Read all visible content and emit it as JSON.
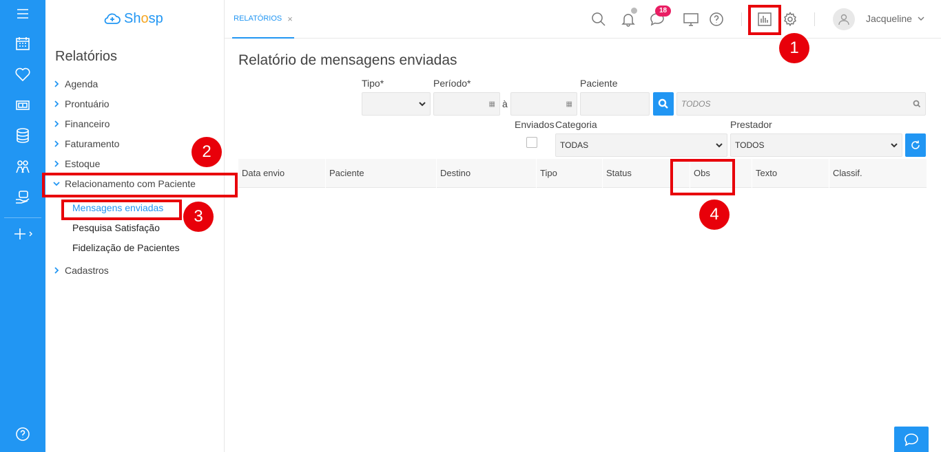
{
  "app": {
    "logo_text_start": "Sh",
    "logo_text_o": "o",
    "logo_text_end": "sp"
  },
  "rail": {
    "icons": [
      "menu-icon",
      "calendar-icon",
      "heart-icon",
      "money-icon",
      "database-icon",
      "people-icon",
      "hand-care-icon",
      "plus-icon"
    ]
  },
  "sidebar": {
    "title": "Relatórios",
    "items": [
      {
        "label": "Agenda"
      },
      {
        "label": "Prontuário"
      },
      {
        "label": "Financeiro"
      },
      {
        "label": "Faturamento"
      },
      {
        "label": "Estoque"
      },
      {
        "label": "Relacionamento com Paciente"
      },
      {
        "label": "Cadastros"
      }
    ],
    "subitems": [
      {
        "label": "Mensagens enviadas"
      },
      {
        "label": "Pesquisa Satisfação"
      },
      {
        "label": "Fidelização de Pacientes"
      }
    ]
  },
  "topbar": {
    "tab_label": "RELATÓRIOS",
    "tab_close": "×",
    "messages_badge": "18",
    "username": "Jacqueline"
  },
  "main": {
    "title": "Relatório de mensagens enviadas",
    "filters": {
      "tipo_label": "Tipo*",
      "periodo_label": "Período*",
      "periodo_sep": "à",
      "paciente_label": "Paciente",
      "paciente_search_placeholder": "TODOS",
      "enviados_label": "Enviados",
      "categoria_label": "Categoria",
      "categoria_value": "TODAS",
      "prestador_label": "Prestador",
      "prestador_value": "TODOS"
    },
    "table_headers": [
      "Data envio",
      "Paciente",
      "Destino",
      "Tipo",
      "Status",
      "Obs",
      "Texto",
      "Classif."
    ]
  },
  "annotations": [
    "1",
    "2",
    "3",
    "4"
  ],
  "colors": {
    "primary": "#2196f3",
    "annotation": "#e8000a",
    "badge": "#e91e63",
    "logo_accent": "#f5a623"
  }
}
